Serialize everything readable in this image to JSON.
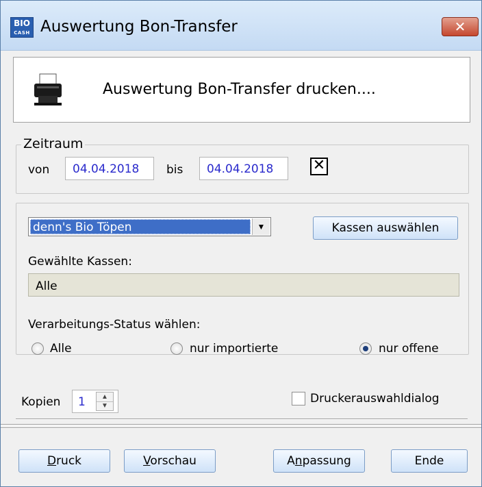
{
  "window": {
    "title": "Auswertung Bon-Transfer",
    "app_icon_top": "BIO",
    "app_icon_bottom": "CASH",
    "close_glyph": "✕"
  },
  "banner": {
    "text": "Auswertung Bon-Transfer drucken...."
  },
  "zeitraum": {
    "legend": "Zeitraum",
    "von_label": "von",
    "von_value": "04.04.2018",
    "bis_label": "bis",
    "bis_value": "04.04.2018",
    "clear_glyph": "✕"
  },
  "filiale": {
    "selected": "denn's Bio Töpen",
    "kassen_button": "Kassen auswählen",
    "gewaehlte_label": "Gewählte Kassen:",
    "gewaehlte_value": "Alle"
  },
  "status": {
    "label": "Verarbeitungs-Status wählen:",
    "options": [
      {
        "label": "Alle",
        "checked": false
      },
      {
        "label": "nur importierte",
        "checked": false
      },
      {
        "label": "nur offene",
        "checked": true
      }
    ]
  },
  "kopien": {
    "label": "Kopien",
    "value": "1"
  },
  "druckerauswahl": {
    "label": "Druckerauswahldialog",
    "checked": false
  },
  "buttons": {
    "druck_first": "D",
    "druck_rest": "ruck",
    "vorschau_first": "V",
    "vorschau_rest": "orschau",
    "anpassung_pre": "A",
    "anpassung_mid": "n",
    "anpassung_rest": "passung",
    "ende": "Ende"
  }
}
